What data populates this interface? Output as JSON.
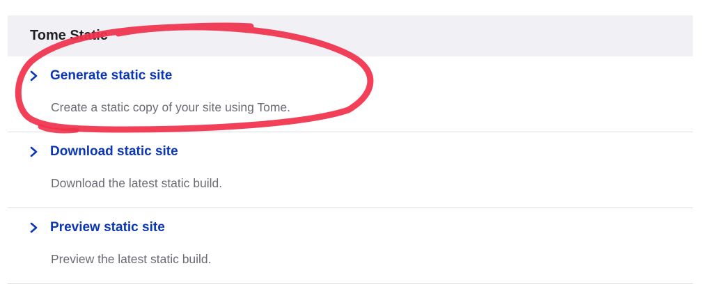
{
  "section": {
    "title": "Tome Static"
  },
  "items": [
    {
      "label": "Generate static site",
      "description": "Create a static copy of your site using Tome."
    },
    {
      "label": "Download static site",
      "description": "Download the latest static build."
    },
    {
      "label": "Preview static site",
      "description": "Preview the latest static build."
    }
  ],
  "icons": {
    "item_icon": "chevron-right-icon"
  },
  "colors": {
    "link": "#0a36b8",
    "description": "#6b6b73",
    "header_bg": "#f0f0f5",
    "annotation": "#f0324b"
  }
}
